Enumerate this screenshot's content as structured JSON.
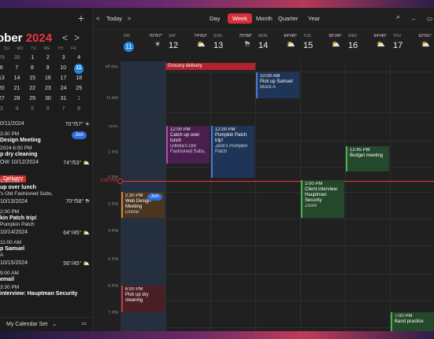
{
  "sidebar": {
    "add_label": "+",
    "month_name": "ober",
    "year": "2024",
    "nav_prev": "<",
    "nav_next": ">",
    "dows": [
      "SU",
      "MO",
      "TU",
      "WE",
      "TH",
      "FR"
    ],
    "weeks": [
      [
        "29",
        "30",
        "1",
        "2",
        "3",
        "4"
      ],
      [
        "6",
        "7",
        "8",
        "9",
        "10",
        "11"
      ],
      [
        "13",
        "14",
        "15",
        "16",
        "17",
        "18"
      ],
      [
        "20",
        "21",
        "22",
        "23",
        "24",
        "25"
      ],
      [
        "27",
        "28",
        "29",
        "30",
        "31",
        "1"
      ],
      [
        "3",
        "4",
        "5",
        "6",
        "7",
        "8"
      ]
    ],
    "agenda": [
      {
        "kind": "day",
        "text": "0/11/2024",
        "wx": "70°/57° ☀"
      },
      {
        "kind": "item",
        "time": "3:30 PM",
        "title": "Design Meeting",
        "join": "Join"
      },
      {
        "kind": "item",
        "time": "2024 6:00 PM",
        "title": "p dry cleaning"
      },
      {
        "kind": "day",
        "text": "OW 10/12/2024",
        "wx": "74°/53° ⛅"
      },
      {
        "kind": "tag",
        "text": "Delivery"
      },
      {
        "kind": "item",
        "time": "1:30 PM",
        "title": "up over lunch",
        "sub": "'s Old Fashioned Subs,"
      },
      {
        "kind": "day",
        "text": "10/13/2024",
        "wx": "70°/58° ⛈"
      },
      {
        "kind": "item",
        "time": "2:00 PM",
        "title": "kin Patch trip!",
        "sub": "Pumpkin Patch"
      },
      {
        "kind": "day",
        "text": "10/14/2024",
        "wx": "64°/45° ⛅"
      },
      {
        "kind": "item",
        "time": "11:00 AM",
        "title": "p Samuel",
        "sub": "A"
      },
      {
        "kind": "day",
        "text": "10/15/2024",
        "wx": "56°/45° ⛅"
      },
      {
        "kind": "item",
        "time": "9:00 AM",
        "title": "email"
      },
      {
        "kind": "item",
        "time": "3:30 PM",
        "title": "interview: Hauptman Security"
      }
    ],
    "footer_label": "My Calendar Set"
  },
  "toolbar": {
    "prev": "<",
    "today": "Today",
    "next": ">",
    "views": [
      "Day",
      "Week",
      "Month",
      "Quarter",
      "Year"
    ],
    "active_view": "Week",
    "search_icon": "search-icon",
    "min_icon": "minimize-icon"
  },
  "days": [
    {
      "name": "FRI",
      "num": "11",
      "temps": "70°/57°",
      "wx": "☀",
      "current": true
    },
    {
      "name": "SAT",
      "num": "12",
      "temps": "74°/53°",
      "wx": "⛅"
    },
    {
      "name": "SUN",
      "num": "13",
      "temps": "70°/58°",
      "wx": "⛈"
    },
    {
      "name": "MON",
      "num": "14",
      "temps": "64°/45°",
      "wx": "⛅"
    },
    {
      "name": "TUE",
      "num": "15",
      "temps": "56°/45°",
      "wx": "⛅"
    },
    {
      "name": "WED",
      "num": "16",
      "temps": "54°/40°",
      "wx": "⛅"
    },
    {
      "name": "THU",
      "num": "17",
      "temps": "62°/51°",
      "wx": "⛅"
    }
  ],
  "time_labels": [
    "all-day",
    "11 AM",
    "noon",
    "1 PM",
    "2 PM",
    "3 PM",
    "4 PM",
    "5 PM",
    "6 PM",
    "7 PM"
  ],
  "now_label": "2:05 PM",
  "allday_event": "Grocery delivery",
  "events": [
    {
      "time": "10:00 AM",
      "title": "Pick up Samuel",
      "sub": "Block A"
    },
    {
      "time": "12:00 PM",
      "title": "Catch up over lunch",
      "sub": "Dillella's Old Fashioned Subs,"
    },
    {
      "time": "12:00 PM",
      "title": "Pumpkin Patch trip!",
      "sub": "Jack's Pumpkin Patch"
    },
    {
      "time": "12:45 PM",
      "title": "Budget meeting"
    },
    {
      "time": "2:00 PM",
      "title": "Client interview: Hauptman Security",
      "sub": "Zoom"
    },
    {
      "time": "2:30 PM",
      "title": "Web Design Meeting",
      "sub": "Online",
      "join": "Join"
    },
    {
      "time": "6:00 PM",
      "title": "Pick up dry cleaning"
    },
    {
      "time": "7:00 PM",
      "title": "Band practice"
    }
  ]
}
